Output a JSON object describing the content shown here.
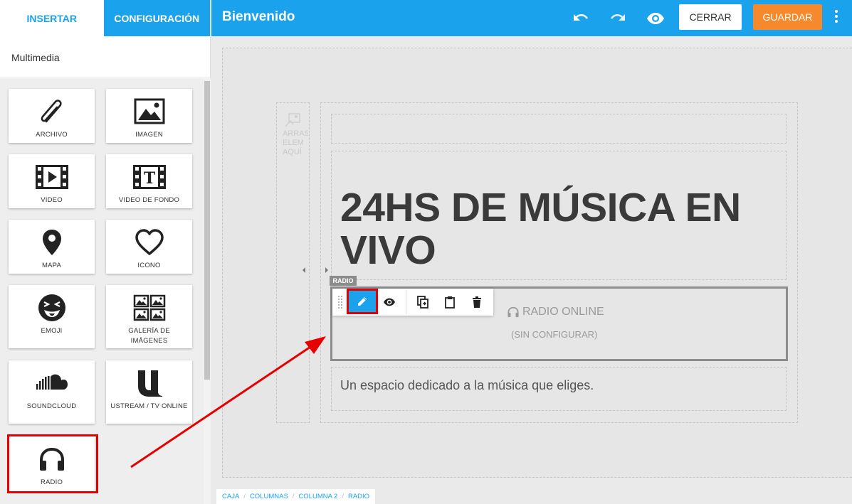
{
  "panel": {
    "tabs": [
      "INSERTAR",
      "CONFIGURACIÓN"
    ],
    "section_title": "Multimedia",
    "tiles": [
      {
        "label": "ARCHIVO",
        "icon": "paperclip-icon"
      },
      {
        "label": "IMAGEN",
        "icon": "image-icon"
      },
      {
        "label": "VIDEO",
        "icon": "video-icon"
      },
      {
        "label": "VIDEO DE FONDO",
        "icon": "video-background-icon"
      },
      {
        "label": "MAPA",
        "icon": "map-pin-icon"
      },
      {
        "label": "ICONO",
        "icon": "heart-icon"
      },
      {
        "label": "EMOJI",
        "icon": "emoji-icon"
      },
      {
        "label": "GALERÍA DE IMÁGENES",
        "icon": "gallery-icon"
      },
      {
        "label": "SOUNDCLOUD",
        "icon": "soundcloud-icon"
      },
      {
        "label": "USTREAM / TV ONLINE",
        "icon": "ustream-icon"
      },
      {
        "label": "RADIO",
        "icon": "headphones-icon"
      }
    ]
  },
  "topbar": {
    "title": "Bienvenido",
    "cerrar_label": "CERRAR",
    "guardar_label": "GUARDAR"
  },
  "editor": {
    "drop_hint": [
      "ARRAS",
      "ELEM",
      "AQUÍ"
    ],
    "heading": "24HS DE MÚSICA EN VIVO",
    "radio_tag": "RADIO",
    "radio_title": "RADIO ONLINE",
    "radio_subtitle": "(SIN CONFIGURAR)",
    "paragraph": "Un espacio dedicado a la música que eliges."
  },
  "breadcrumb": [
    "CAJA",
    "COLUMNAS",
    "COLUMNA 2",
    "RADIO"
  ],
  "colors": {
    "accent": "#1aa3ec",
    "save": "#f5892b",
    "highlight": "#e60000"
  }
}
